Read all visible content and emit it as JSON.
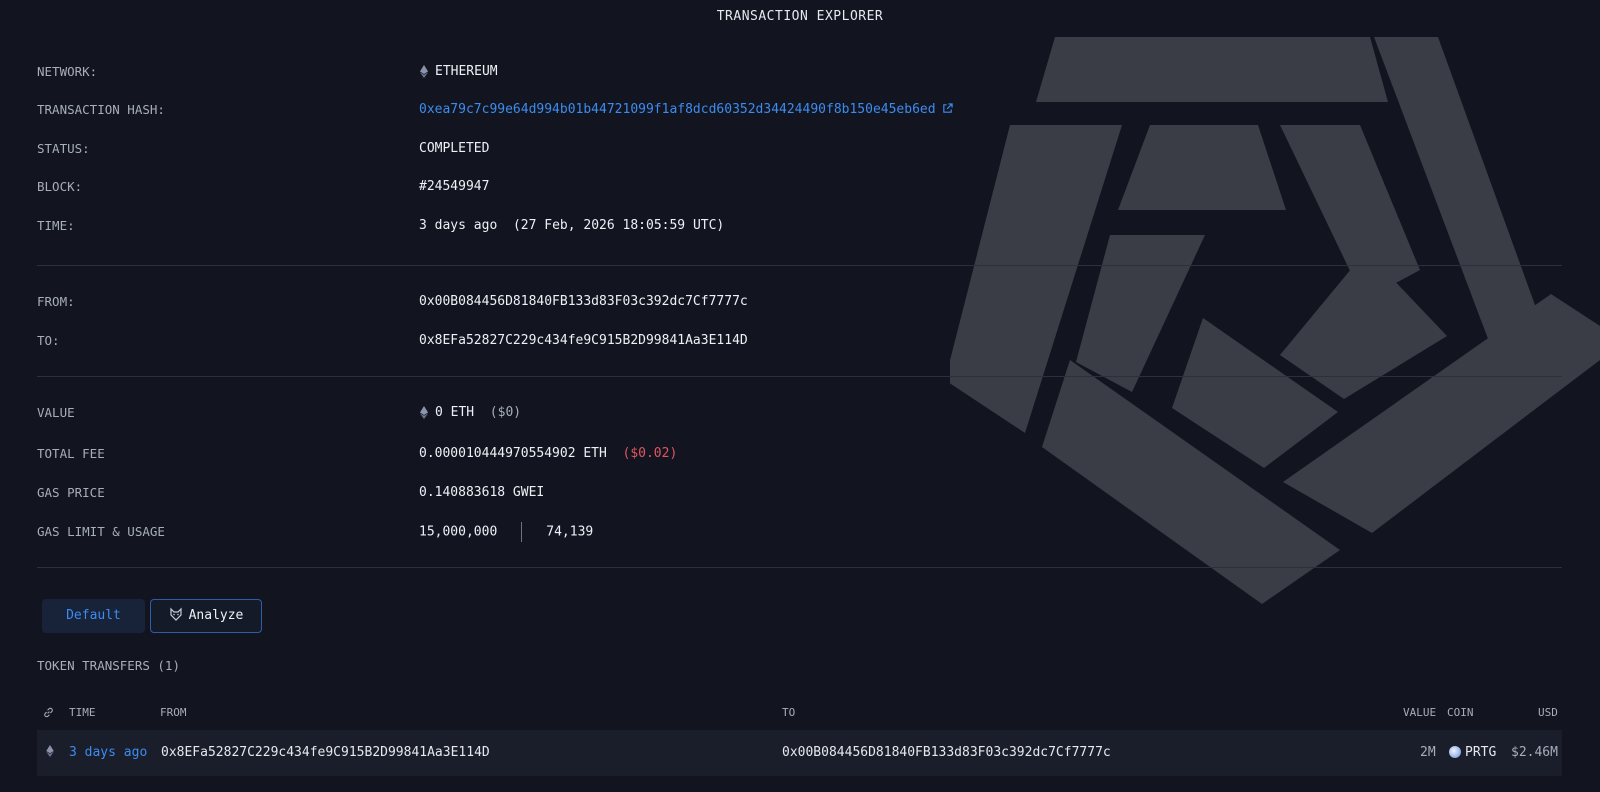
{
  "header": {
    "title": "TRANSACTION EXPLORER"
  },
  "details": {
    "network": {
      "label": "NETWORK:",
      "value": "ETHEREUM"
    },
    "hash": {
      "label": "TRANSACTION HASH:",
      "value": "0xea79c7c99e64d994b01b44721099f1af8dcd60352d34424490f8b150e45eb6ed"
    },
    "status": {
      "label": "STATUS:",
      "value": "COMPLETED"
    },
    "block": {
      "label": "BLOCK:",
      "value": "#24549947"
    },
    "time": {
      "label": "TIME:",
      "relative": "3 days ago",
      "absolute": "(27 Feb, 2026 18:05:59 UTC)"
    },
    "from": {
      "label": "FROM:",
      "value": "0x00B084456D81840FB133d83F03c392dc7Cf7777c"
    },
    "to": {
      "label": "TO:",
      "value": "0x8EFa52827C229c434fe9C915B2D99841Aa3E114D"
    },
    "value": {
      "label": "VALUE",
      "amount": "0 ETH",
      "usd": "($0)"
    },
    "fee": {
      "label": "TOTAL FEE",
      "amount": "0.000010444970554902 ETH",
      "usd": "($0.02)"
    },
    "gas_price": {
      "label": "GAS PRICE",
      "value": "0.140883618 GWEI"
    },
    "gas": {
      "label": "GAS LIMIT & USAGE",
      "limit": "15,000,000",
      "usage": "74,139"
    }
  },
  "tabs": {
    "default": "Default",
    "analyze": "Analyze"
  },
  "transfers": {
    "title": "TOKEN TRANSFERS (1)",
    "columns": {
      "time": "TIME",
      "from": "FROM",
      "to": "TO",
      "value": "VALUE",
      "coin": "COIN",
      "usd": "USD"
    },
    "rows": [
      {
        "time": "3 days ago",
        "from": "0x8EFa52827C229c434fe9C915B2D99841Aa3E114D",
        "to": "0x00B084456D81840FB133d83F03c392dc7Cf7777c",
        "value": "2M",
        "coin": "PRTG",
        "usd": "$2.46M"
      }
    ]
  },
  "colors": {
    "background": "#12151f",
    "link": "#3d8bf0",
    "success": "#58b368",
    "negative": "#e05561"
  },
  "icons": [
    "ethereum-icon",
    "external-link-icon",
    "fox-icon",
    "link-icon",
    "coin-icon"
  ]
}
